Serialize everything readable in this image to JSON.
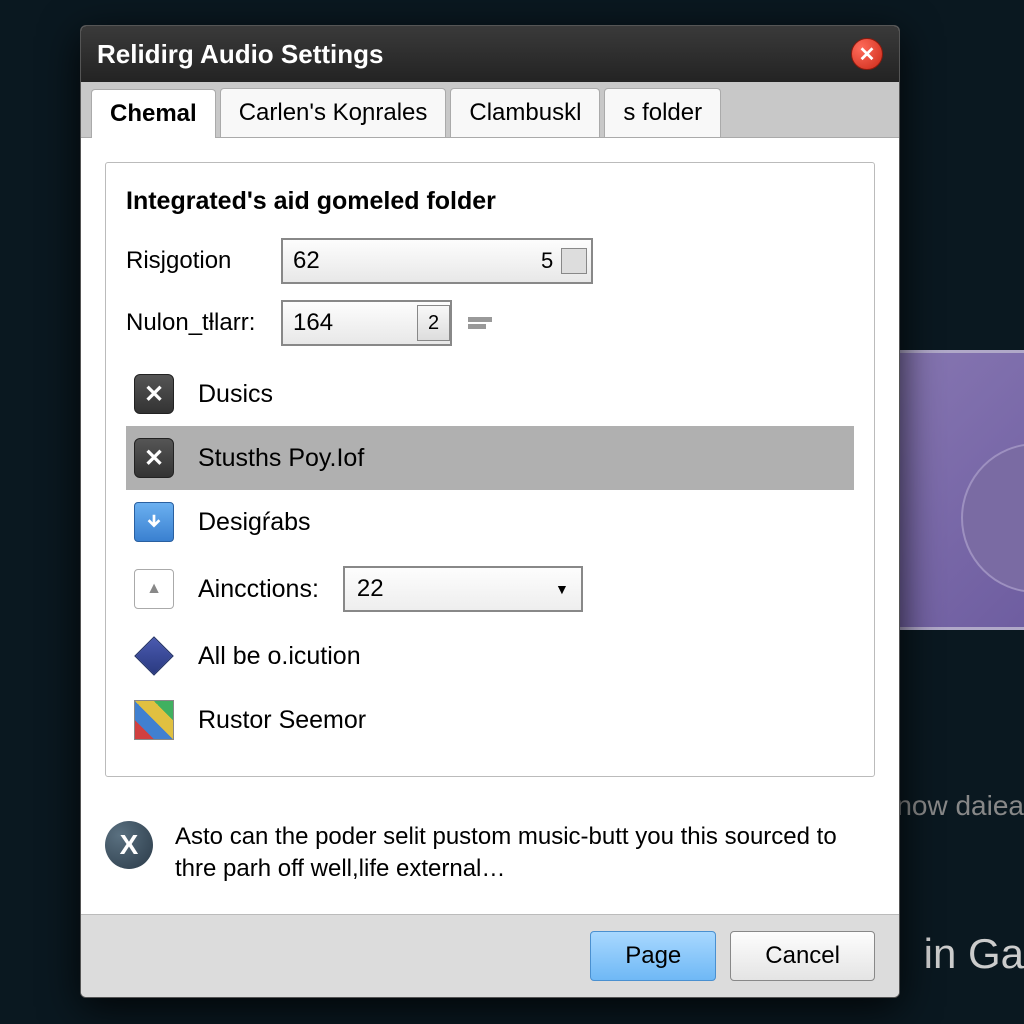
{
  "window": {
    "title": "Relidirg Audio Settings"
  },
  "tabs": [
    {
      "label": "Chemal"
    },
    {
      "label": "Carlen's Koɲrales"
    },
    {
      "label": "Clambuskl"
    },
    {
      "label": "s folder"
    }
  ],
  "group": {
    "title": "Integrated's aid gomeled folder",
    "risjgotion": {
      "label": "Risjgotion",
      "value": "62",
      "aux": "5"
    },
    "nulon": {
      "label": "Nulon_tƚlarr:",
      "value": "164",
      "btn": "2"
    },
    "list": [
      {
        "label": "Dusics"
      },
      {
        "label": "Stusths Poy.Iof"
      },
      {
        "label": "Desigŕabs"
      },
      {
        "label": "Aincctions:",
        "combo": "22"
      },
      {
        "label": "All be o.icution"
      },
      {
        "label": "Rustor Seemor"
      }
    ]
  },
  "info": {
    "text": "Asto can the poder selit pustom music-butt you this sourced to thre parh off well,life external…"
  },
  "buttons": {
    "primary": "Page",
    "cancel": "Cancel"
  },
  "background": {
    "text1": "now daiea",
    "text2": "in Ga"
  }
}
